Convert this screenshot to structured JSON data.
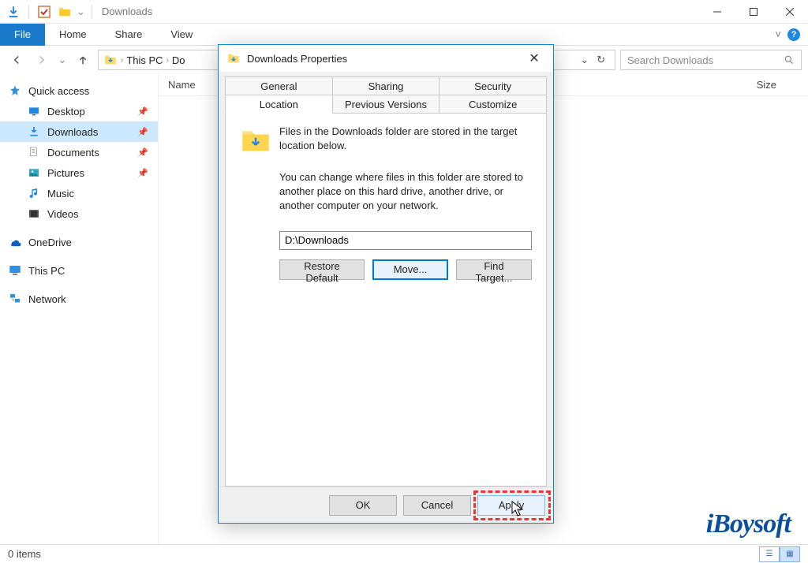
{
  "window": {
    "title": "Downloads",
    "minimize": "–",
    "maximize": "□",
    "close": "✕"
  },
  "ribbon": {
    "file": "File",
    "tabs": [
      "Home",
      "Share",
      "View"
    ],
    "caret": "˅",
    "help": "?"
  },
  "address": {
    "segments": [
      "This PC",
      "Do"
    ],
    "refresh": "↻",
    "search_placeholder": "Search Downloads"
  },
  "columns": {
    "name": "Name",
    "size": "Size"
  },
  "sidebar": {
    "quick_access": "Quick access",
    "items": [
      {
        "label": "Desktop",
        "icon": "desktop"
      },
      {
        "label": "Downloads",
        "icon": "downloads"
      },
      {
        "label": "Documents",
        "icon": "documents"
      },
      {
        "label": "Pictures",
        "icon": "pictures"
      },
      {
        "label": "Music",
        "icon": "music"
      },
      {
        "label": "Videos",
        "icon": "videos"
      }
    ],
    "onedrive": "OneDrive",
    "this_pc": "This PC",
    "network": "Network"
  },
  "statusbar": {
    "items": "0 items"
  },
  "dialog": {
    "title": "Downloads Properties",
    "tabs_row1": [
      "General",
      "Sharing",
      "Security"
    ],
    "tabs_row2": [
      "Location",
      "Previous Versions",
      "Customize"
    ],
    "active_tab": "Location",
    "info1": "Files in the Downloads folder are stored in the target location below.",
    "info2": "You can change where files in this folder are stored to another place on this hard drive, another drive, or another computer on your network.",
    "path": "D:\\Downloads",
    "buttons": {
      "restore": "Restore Default",
      "move": "Move...",
      "find": "Find Target...",
      "ok": "OK",
      "cancel": "Cancel",
      "apply": "Apply"
    }
  },
  "watermark": "iBoysoft"
}
